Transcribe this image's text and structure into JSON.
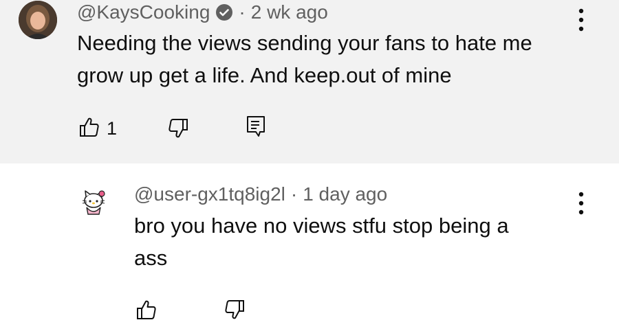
{
  "comments": [
    {
      "handle": "@KaysCooking",
      "time": "2 wk ago",
      "text_line1": "Needing the views sending your fans to hate me",
      "text_line2": "grow up get a life. And keep.out of mine",
      "like_count": "1",
      "verified_icon": "verified-check-icon"
    },
    {
      "handle": "@user-gx1tq8ig2l",
      "time": "1 day ago",
      "text_line1": "bro you have no views stfu stop being a",
      "text_line2": "ass"
    }
  ],
  "colors": {
    "top_background": "#f2f2f2",
    "reply_background": "#ffffff",
    "meta_text": "#606060",
    "body_text": "#0f0f0f"
  }
}
